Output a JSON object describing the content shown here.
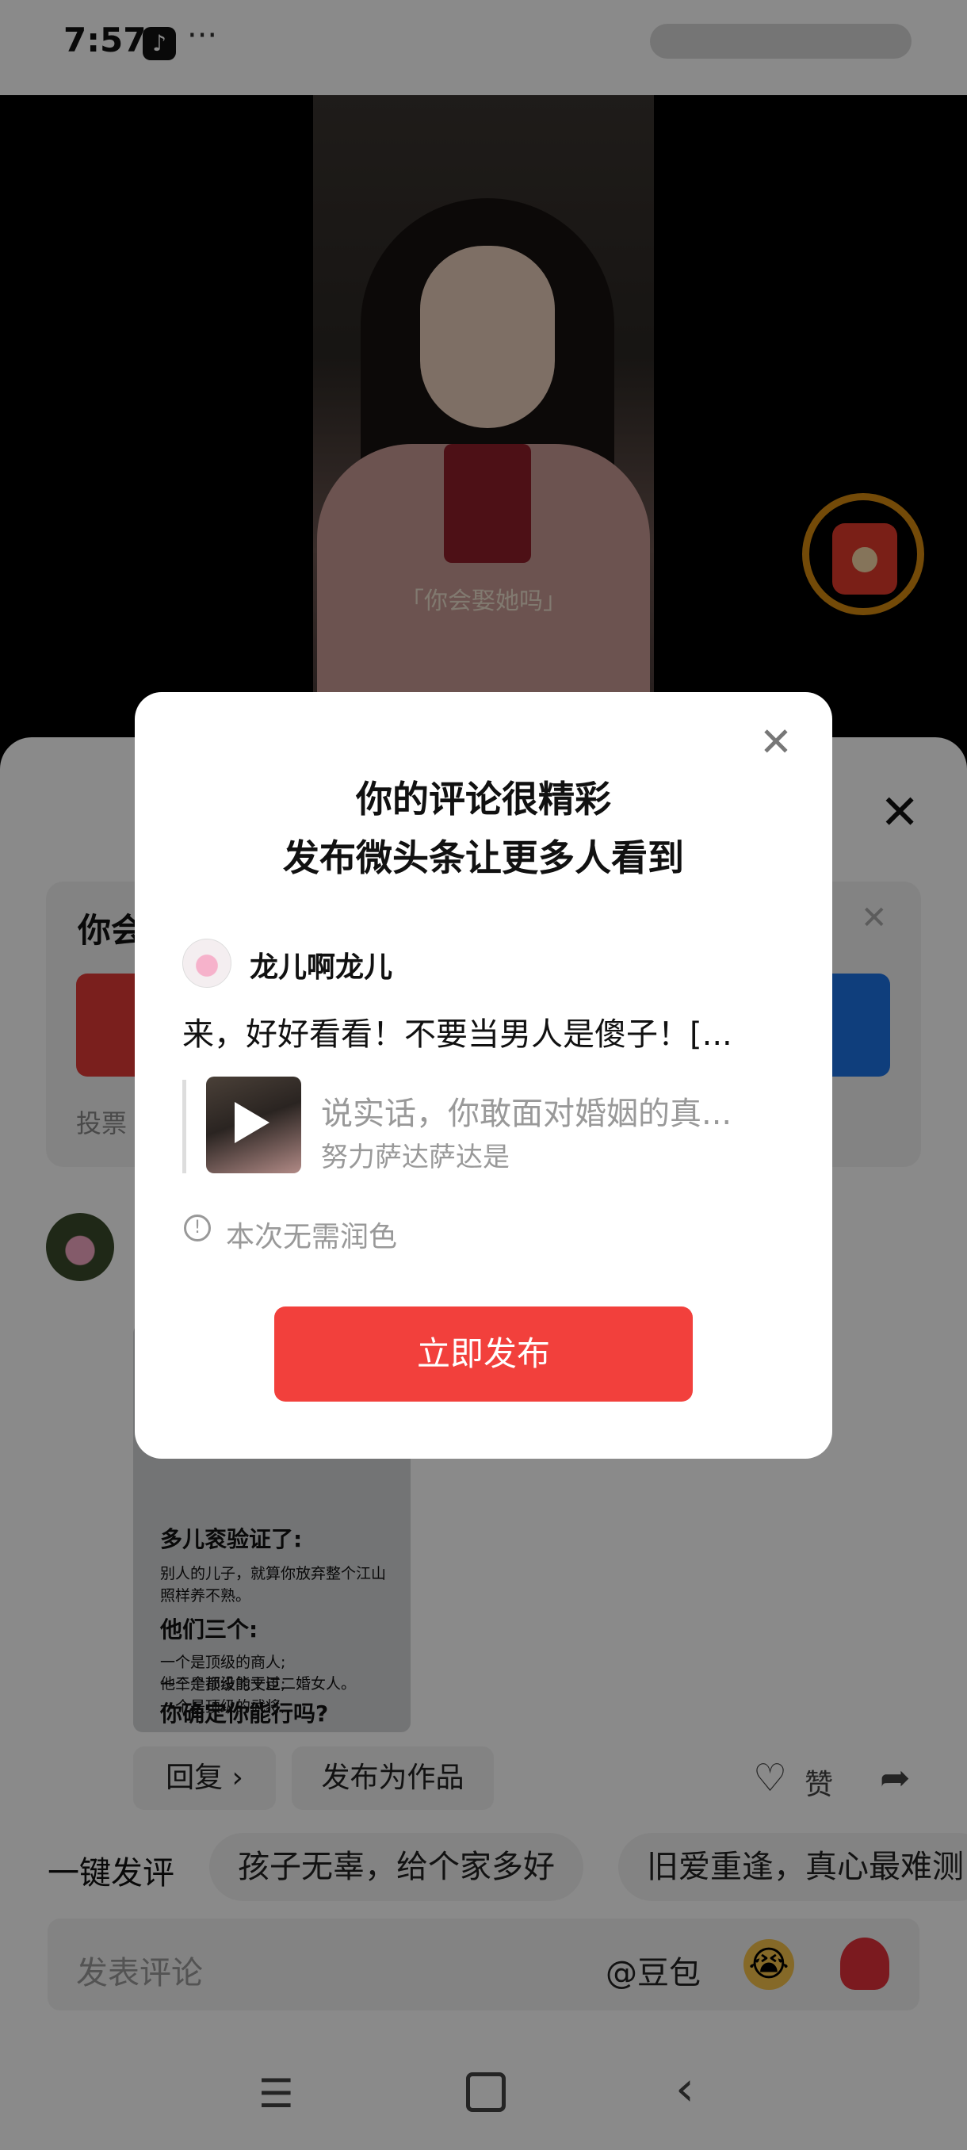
{
  "status_bar": {
    "time": "7:57",
    "tiktok_icon": "♪",
    "more": "···"
  },
  "video": {
    "caption": "「你会娶她吗」"
  },
  "comment_sheet": {
    "close_icon": "✕",
    "vote": {
      "title": "你会",
      "close_icon": "✕",
      "count_label": "投票"
    },
    "comment_image": {
      "lines": [
        "多儿衮验证了:",
        "别人的儿子，就算你放弃整个江山",
        "照样养不熟。",
        "他们三个:",
        "一个是顶级的商人;",
        "一个是顶级的文臣;",
        "一个是顶级的武将;",
        "他三个都没能干过二婚女人。",
        "你确定你能行吗?"
      ]
    },
    "reply_label": "回复 ›",
    "publish_work_label": "发布为作品",
    "like_icon": "♡",
    "like_label": "赞",
    "share_icon": "➦",
    "quick_comment_label": "一键发评",
    "chips": [
      "孩子无辜，给个家多好",
      "旧爱重逢，真心最难测"
    ],
    "input_placeholder": "发表评论",
    "doubao_label": "@豆包",
    "emoji_cry": "😭"
  },
  "dialog": {
    "close_icon": "✕",
    "title_line1": "你的评论很精彩",
    "title_line2": "发布微头条让更多人看到",
    "username": "龙儿啊龙儿",
    "post_text": "来，好好看看！不要当男人是傻子！[...",
    "quote_title": "说实话，你敢面对婚姻的真...",
    "quote_author": "努力萨达萨达是",
    "notice_icon": "!",
    "notice_text": "本次无需润色",
    "publish_button": "立即发布"
  },
  "nav_bar": {
    "menu_icon": "☰",
    "back_icon": "‹"
  },
  "colors": {
    "publish_red": "#f2403c",
    "vote_blue": "#1d73e6",
    "vote_red": "#e13a36",
    "redpacket_ring": "#d4890f"
  }
}
